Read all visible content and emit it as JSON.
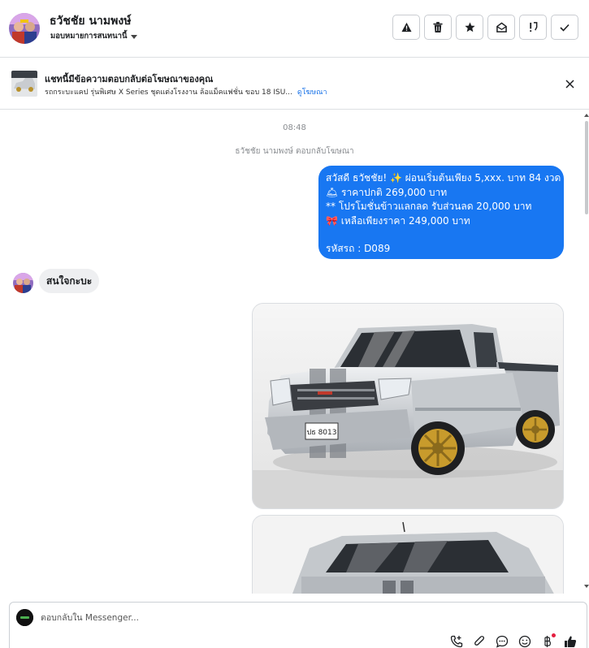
{
  "header": {
    "contact_name": "ธวัชชัย นามพงษ์",
    "assign_label": "มอบหมายการสนทนานี้",
    "actions": [
      {
        "name": "report-spam-button",
        "icon": "warning-icon"
      },
      {
        "name": "delete-button",
        "icon": "trash-icon"
      },
      {
        "name": "follow-up-button",
        "icon": "star-icon"
      },
      {
        "name": "mark-unread-button",
        "icon": "envelope-open-icon"
      },
      {
        "name": "mark-important-button",
        "icon": "exclamation-icon"
      },
      {
        "name": "mark-done-button",
        "icon": "check-icon"
      }
    ]
  },
  "banner": {
    "title": "แชทนี้มีข้อความตอบกลับต่อโฆษณาของคุณ",
    "description": "รถกระบะแคป รุ่นพิเศษ X Series ชุดแต่งโรงงาน ล้อแม็คแฟชั่น ขอบ 18 ISU...",
    "link": "ดูโฆษณา"
  },
  "chat": {
    "time": "08:48",
    "system_text": "ธวัชชัย นามพงษ์ ตอบกลับโฆษณา",
    "outgoing_lines": [
      "สวัสดี ธวัชชัย! ✨  ผ่อนเริ่มต้นเพียง 5,xxx. บาท 84 งวด",
      "🛎 ราคาปกติ 269,000 บาท",
      "** โปรโมชั่นข้าวแลกลด รับส่วนลด 20,000 บาท",
      "🎀  เหลือเพียงราคา 249,000 บาท",
      "",
      " รหัสรถ : D089"
    ],
    "incoming_text": "สนใจกะบะ",
    "plate_text": "ปธ 8013"
  },
  "composer": {
    "placeholder": "ตอบกลับใน Messenger..."
  },
  "colors": {
    "accent": "#1877f2",
    "incoming_bubble": "#eeeff1",
    "notification_dot": "#e41e3f"
  }
}
